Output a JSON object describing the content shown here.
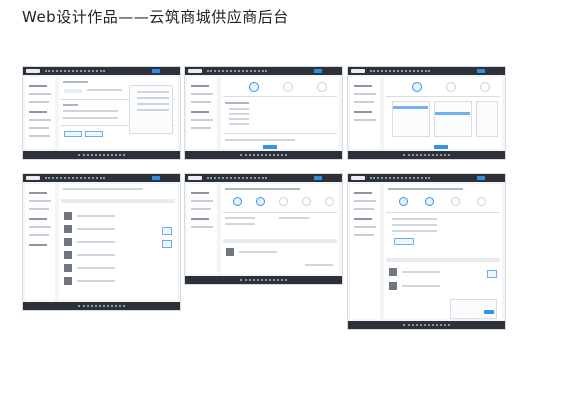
{
  "title": "Web设计作品——云筑商城供应商后台",
  "screenshots": [
    {
      "name": "dashboard-screen"
    },
    {
      "name": "step-form-screen"
    },
    {
      "name": "category-select-screen"
    },
    {
      "name": "product-list-screen"
    },
    {
      "name": "order-detail-screen"
    },
    {
      "name": "order-process-screen"
    }
  ],
  "colors": {
    "accent": "#3592e8",
    "nav": "#2d323a",
    "background": "#f4f5f7"
  }
}
